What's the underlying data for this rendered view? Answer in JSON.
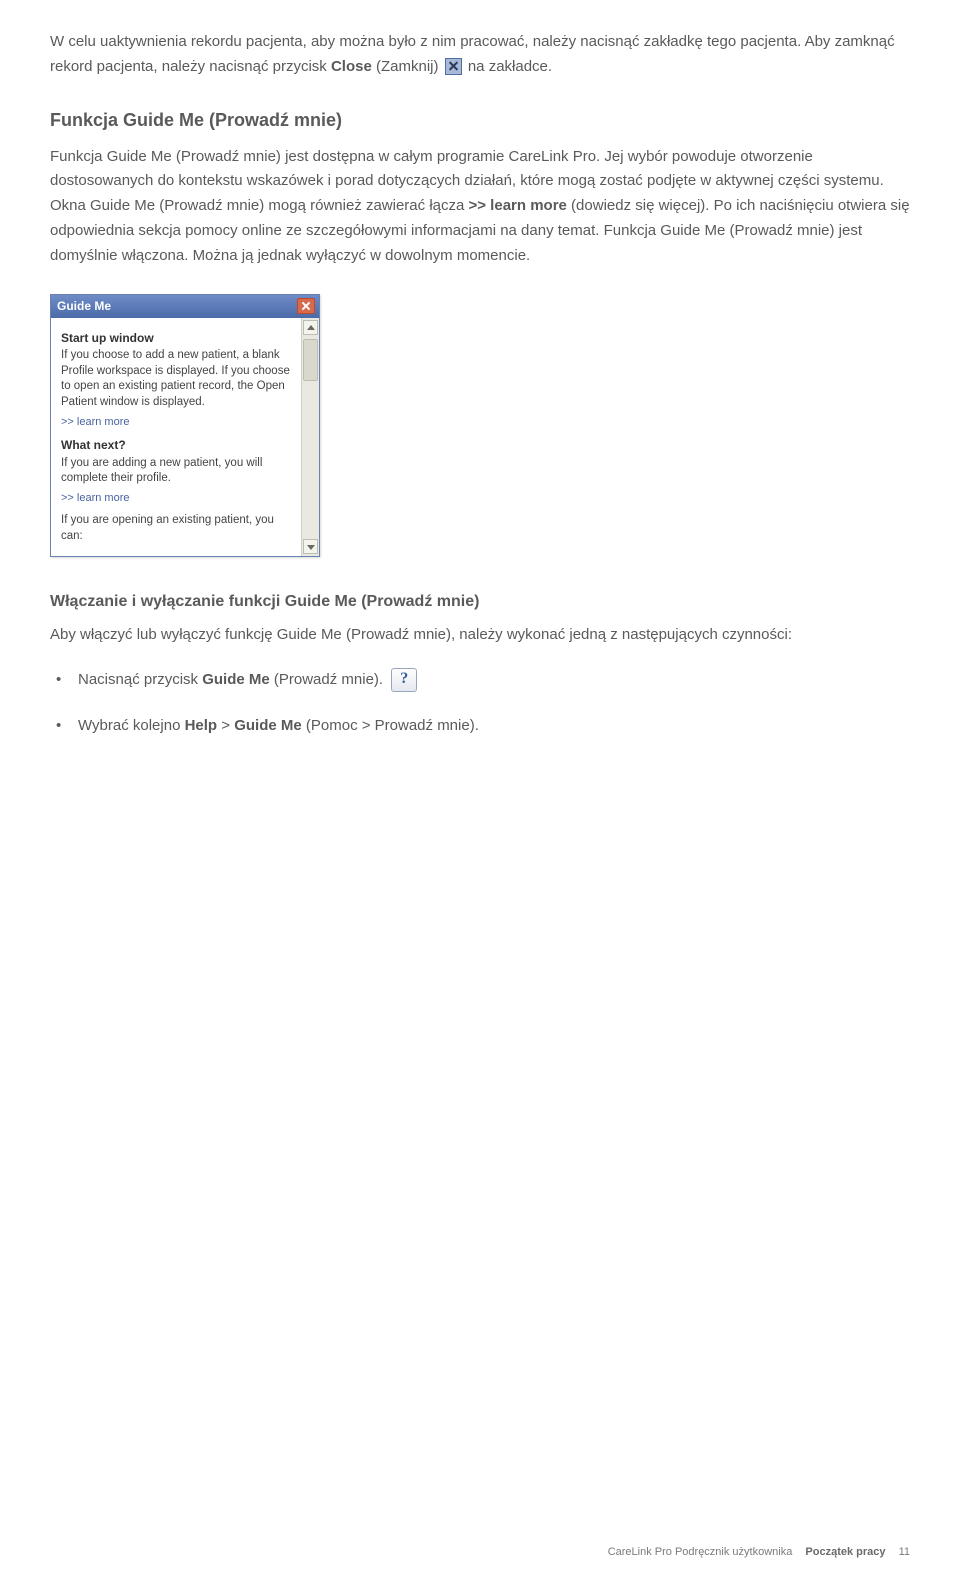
{
  "para1": {
    "pre": "W celu uaktywnienia rekordu pacjenta, aby można było z nim pracować, należy nacisnąć zakładkę tego pacjenta. Aby zamknąć rekord pacjenta, należy nacisnąć przycisk ",
    "bold": "Close",
    "mid": " (Zamknij) ",
    "post": " na zakładce."
  },
  "heading1": "Funkcja Guide Me (Prowadź mnie)",
  "para2": {
    "a": "Funkcja Guide Me (Prowadź mnie) jest dostępna w całym programie CareLink Pro. Jej wybór powoduje otworzenie dostosowanych do kontekstu wskazówek i porad dotyczących działań, które mogą zostać podjęte w aktywnej części systemu. Okna Guide Me (Prowadź mnie) mogą również zawierać łącza ",
    "b": ">> learn more",
    "c": " (dowiedz się więcej). Po ich naciśnięciu otwiera się odpowiednia sekcja pomocy online ze szczegółowymi informacjami na dany temat. Funkcja Guide Me (Prowadź mnie) jest domyślnie włączona. Można ją jednak wyłączyć w dowolnym momencie."
  },
  "guideme": {
    "title": "Guide Me",
    "sec1_title": "Start up window",
    "sec1_text": "If you choose to add a new patient, a blank Profile workspace is displayed. If you choose to open an existing patient record, the Open Patient window is displayed.",
    "learn1": ">> learn more",
    "sec2_title": "What next?",
    "sec2_text": "If you are adding a new patient, you will complete their profile.",
    "learn2": ">> learn more",
    "sec3_text": "If you are opening an existing patient, you can:"
  },
  "heading2": "Włączanie i wyłączanie funkcji Guide Me (Prowadź mnie)",
  "para3": "Aby włączyć lub wyłączyć funkcję Guide Me (Prowadź mnie), należy wykonać jedną z następujących czynności:",
  "bullets": {
    "b1_a": "Nacisnąć przycisk ",
    "b1_b": "Guide Me",
    "b1_c": " (Prowadź mnie). ",
    "b2_a": "Wybrać kolejno ",
    "b2_b": "Help",
    "b2_c": " > ",
    "b2_d": "Guide Me",
    "b2_e": " (Pomoc > Prowadź mnie)."
  },
  "footer": {
    "doc": "CareLink Pro Podręcznik użytkownika",
    "section": "Początek pracy",
    "page": "11"
  }
}
